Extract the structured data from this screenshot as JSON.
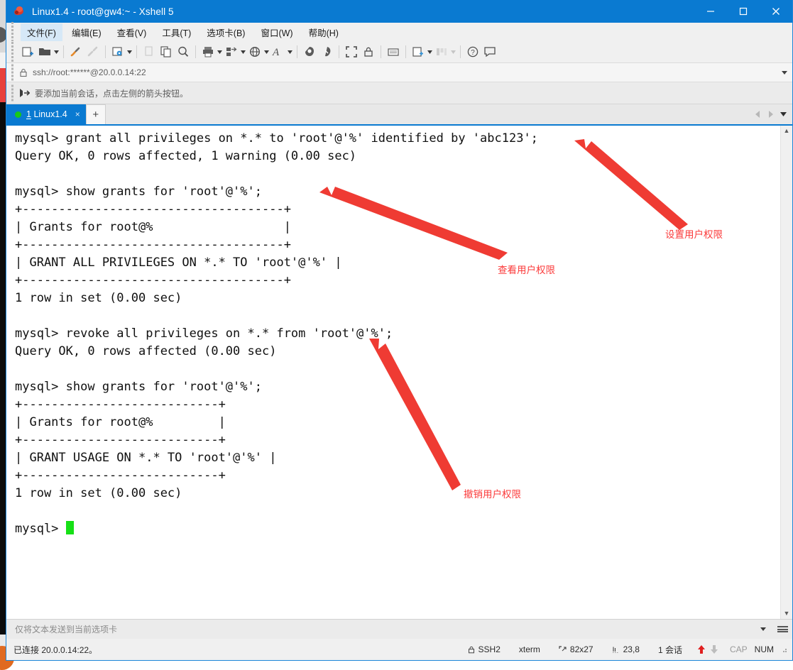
{
  "window": {
    "title": "Linux1.4 - root@gw4:~ - Xshell 5",
    "app_icon": "xshell-icon",
    "minimize": "minimize",
    "maximize": "maximize",
    "close": "close"
  },
  "menu": {
    "items": [
      {
        "label": "文件(F)",
        "name": "menu-file",
        "active": true
      },
      {
        "label": "编辑(E)",
        "name": "menu-edit",
        "active": false
      },
      {
        "label": "查看(V)",
        "name": "menu-view",
        "active": false
      },
      {
        "label": "工具(T)",
        "name": "menu-tools",
        "active": false
      },
      {
        "label": "选项卡(B)",
        "name": "menu-tabs",
        "active": false
      },
      {
        "label": "窗口(W)",
        "name": "menu-window",
        "active": false
      },
      {
        "label": "帮助(H)",
        "name": "menu-help",
        "active": false
      }
    ]
  },
  "toolbar": {
    "icons": [
      "new-session-icon",
      "open-folder-icon",
      "dropdown-caret",
      "separator",
      "connect-icon",
      "disconnect-icon",
      "separator",
      "session-properties-icon",
      "dropdown-caret",
      "separator",
      "cut-icon",
      "copy-paste-icon",
      "find-icon",
      "separator",
      "print-icon",
      "dropdown-caret",
      "transfer-icon",
      "dropdown-caret",
      "globe-icon",
      "dropdown-caret",
      "font-icon",
      "dropdown-caret",
      "separator",
      "ssh-tunnel-icon",
      "highlight-icon",
      "separator",
      "fullscreen-icon",
      "lock-icon",
      "separator",
      "compose-pane-icon",
      "separator",
      "add-pane-icon",
      "dropdown-caret",
      "arrange-icon",
      "dropdown-caret",
      "separator",
      "help-icon",
      "feedback-icon"
    ]
  },
  "address": {
    "lock_icon": "lock-icon",
    "value": "ssh://root:******@20.0.0.14:22",
    "caret_icon": "chevron-down-icon"
  },
  "hint": {
    "icon": "add-session-arrow-icon",
    "text": "要添加当前会话，点击左侧的箭头按钮。"
  },
  "tabs": {
    "items": [
      {
        "index": "1",
        "label": "Linux1.4",
        "status": "connected",
        "close": "×"
      }
    ],
    "add_label": "+",
    "nav_prev": "prev-tab",
    "nav_next": "next-tab",
    "nav_list": "tab-list"
  },
  "terminal": {
    "lines": [
      "mysql> grant all privileges on *.* to 'root'@'%' identified by 'abc123';",
      "Query OK, 0 rows affected, 1 warning (0.00 sec)",
      "",
      "mysql> show grants for 'root'@'%';",
      "+------------------------------------+",
      "| Grants for root@%                  |",
      "+------------------------------------+",
      "| GRANT ALL PRIVILEGES ON *.* TO 'root'@'%' |",
      "+------------------------------------+",
      "1 row in set (0.00 sec)",
      "",
      "mysql> revoke all privileges on *.* from 'root'@'%';",
      "Query OK, 0 rows affected (0.00 sec)",
      "",
      "mysql> show grants for 'root'@'%';",
      "+---------------------------+",
      "| Grants for root@%         |",
      "+---------------------------+",
      "| GRANT USAGE ON *.* TO 'root'@'%' |",
      "+---------------------------+",
      "1 row in set (0.00 sec)",
      "",
      "mysql> "
    ],
    "cursor": "block-cursor",
    "scroll_up": "▲",
    "scroll_down": "▼"
  },
  "annotations": {
    "color": "#fb3b3b",
    "items": [
      {
        "text": "设置用户权限",
        "name": "annotation-set-privileges"
      },
      {
        "text": "查看用户权限",
        "name": "annotation-view-privileges"
      },
      {
        "text": "撤销用户权限",
        "name": "annotation-revoke-privileges"
      }
    ]
  },
  "send_bar": {
    "text": "仅将文本发送到当前选项卡",
    "caret_icon": "chevron-down-icon",
    "menu_icon": "hamburger-icon"
  },
  "status": {
    "left": "已连接 20.0.0.14:22。",
    "protocol_icon": "lock-icon",
    "protocol": "SSH2",
    "terminal_type": "xterm",
    "size_icon": "screen-size-icon",
    "size": "82x27",
    "cursor_icon": "cursor-pos-icon",
    "cursor_pos": "23,8",
    "sessions": "1 会话",
    "upload_icon": "arrow-up-icon",
    "download_icon": "arrow-down-icon",
    "cap": "CAP",
    "num": "NUM"
  }
}
